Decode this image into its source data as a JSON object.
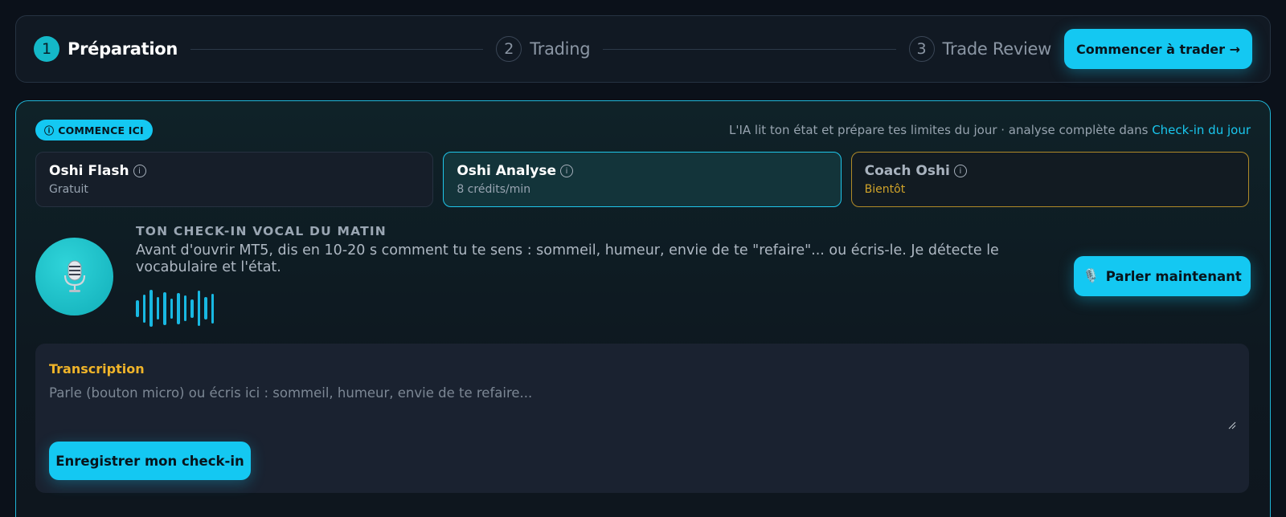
{
  "stepper": {
    "steps": [
      {
        "number": "1",
        "label": "Préparation",
        "active": true
      },
      {
        "number": "2",
        "label": "Trading",
        "active": false
      },
      {
        "number": "3",
        "label": "Trade Review",
        "active": false
      }
    ],
    "start_button": "Commencer à trader →"
  },
  "panel": {
    "badge": "COMMENCE ICI",
    "badge_icon": "info-icon",
    "hint_text": "L'IA lit ton état et prépare tes limites du jour · analyse complète dans ",
    "hint_link": "Check-in du jour",
    "modes": [
      {
        "title": "Oshi Flash",
        "subtitle": "Gratuit",
        "state": "default"
      },
      {
        "title": "Oshi Analyse",
        "subtitle": "8 crédits/min",
        "state": "selected"
      },
      {
        "title": "Coach Oshi",
        "subtitle": "Bientôt",
        "state": "soon"
      }
    ]
  },
  "voice": {
    "icon": "microphone-icon",
    "title": "TON CHECK-IN VOCAL DU MATIN",
    "description": "Avant d'ouvrir MT5, dis en 10-20 s comment tu te sens : sommeil, humeur, envie de te \"refaire\"... ou écris-le. Je détecte le vocabulaire et l'état.",
    "talk_button": "Parler maintenant",
    "waveform_levels": [
      0.45,
      0.75,
      1.0,
      0.6,
      0.9,
      0.55,
      0.85,
      0.7,
      0.5,
      0.95,
      0.6,
      0.8
    ]
  },
  "transcription": {
    "label": "Transcription",
    "placeholder": "Parle (bouton micro) ou écris ici : sommeil, humeur, envie de te refaire...",
    "value": "",
    "save_button": "Enregistrer mon check-in"
  },
  "colors": {
    "accent": "#14c8f2",
    "warning": "#f0b429",
    "soon": "#d0a32a",
    "background": "#0b111a"
  }
}
